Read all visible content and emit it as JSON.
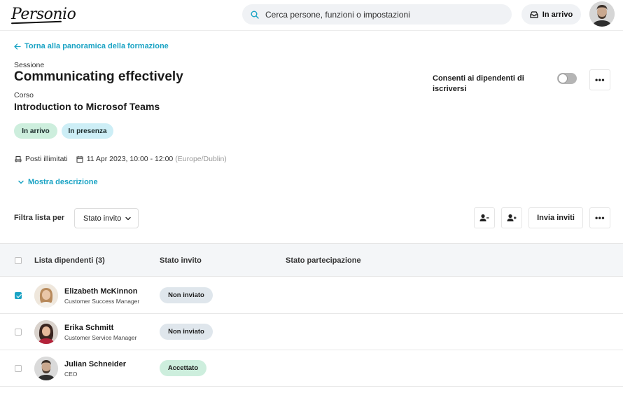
{
  "app": {
    "logo": "Personio"
  },
  "search": {
    "placeholder": "Cerca persone, funzioni o impostazioni"
  },
  "header": {
    "inbox_label": "In arrivo"
  },
  "nav": {
    "back_link": "Torna alla panoramica della formazione"
  },
  "session": {
    "session_label": "Sessione",
    "title": "Communicating effectively",
    "course_label": "Corso",
    "course_name": "Introduction to Microsof Teams",
    "badges": [
      "In arrivo",
      "In presenza"
    ],
    "seats": "Posti illimitati",
    "datetime": "11 Apr 2023, 10:00 - 12:00",
    "timezone": "(Europe/Dublin)",
    "show_description": "Mostra descrizione",
    "allow_signup_label": "Consenti ai dipendenti di iscriversi",
    "allow_signup_enabled": false
  },
  "toolbar": {
    "filter_label": "Filtra lista per",
    "filter_value": "Stato invito",
    "send_invites": "Invia inviti"
  },
  "table": {
    "columns": [
      "Lista dipendenti (3)",
      "Stato invito",
      "Stato partecipazione"
    ],
    "rows": [
      {
        "name": "Elizabeth McKinnon",
        "role": "Customer Success Manager",
        "invite_status": "Non inviato",
        "checked": true
      },
      {
        "name": "Erika Schmitt",
        "role": "Customer Service Manager",
        "invite_status": "Non inviato",
        "checked": false
      },
      {
        "name": "Julian Schneider",
        "role": "CEO",
        "invite_status": "Accettato",
        "checked": false
      }
    ]
  },
  "colors": {
    "accent": "#1aa3c4",
    "badge_green": "#cdeedd",
    "badge_blue": "#cdeef6",
    "pill_grey": "#dfe6ec"
  }
}
